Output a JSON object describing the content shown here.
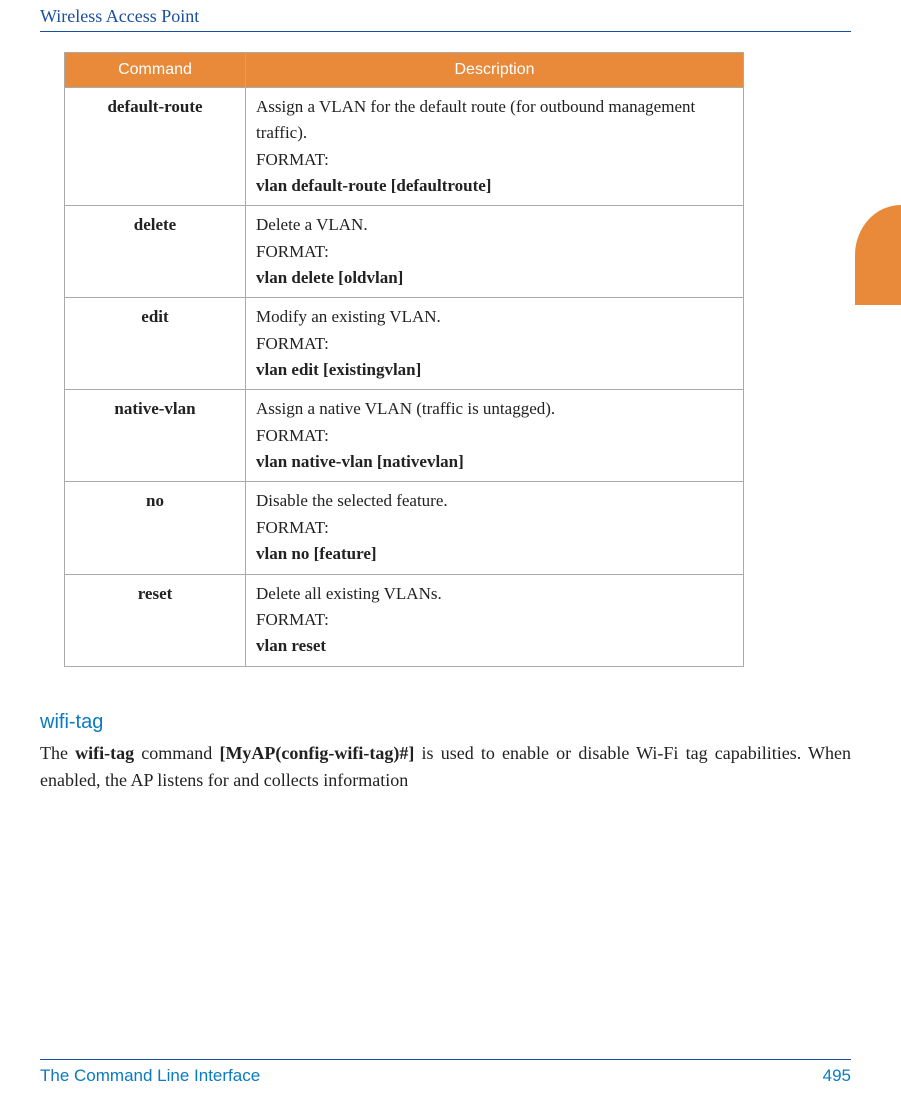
{
  "header": {
    "title": "Wireless Access Point"
  },
  "table": {
    "headers": {
      "command": "Command",
      "description": "Description"
    },
    "rows": [
      {
        "command": "default-route",
        "desc": "Assign a VLAN for the default route (for outbound management traffic).",
        "format_label": "FORMAT:",
        "format_code": "vlan default-route [defaultroute]"
      },
      {
        "command": "delete",
        "desc": "Delete a VLAN.",
        "format_label": "FORMAT:",
        "format_code": "vlan delete [oldvlan]"
      },
      {
        "command": "edit",
        "desc": "Modify an existing VLAN.",
        "format_label": "FORMAT:",
        "format_code": "vlan edit [existingvlan]"
      },
      {
        "command": "native-vlan",
        "desc": "Assign a native VLAN (traffic is untagged).",
        "format_label": "FORMAT:",
        "format_code": "vlan native-vlan [nativevlan]"
      },
      {
        "command": "no",
        "desc": "Disable the selected feature.",
        "format_label": "FORMAT:",
        "format_code": "vlan no [feature]"
      },
      {
        "command": "reset",
        "desc": "Delete all existing VLANs.",
        "format_label": "FORMAT:",
        "format_code": "vlan reset"
      }
    ]
  },
  "section": {
    "heading": "wifi-tag",
    "para_pre": "The ",
    "para_bold1": "wifi-tag",
    "para_mid1": " command ",
    "para_bold2": "[MyAP(config-wifi-tag)#]",
    "para_post": " is used to enable or disable Wi-Fi tag capabilities. When enabled, the AP listens for and collects information"
  },
  "footer": {
    "left": "The Command Line Interface",
    "right": "495"
  }
}
